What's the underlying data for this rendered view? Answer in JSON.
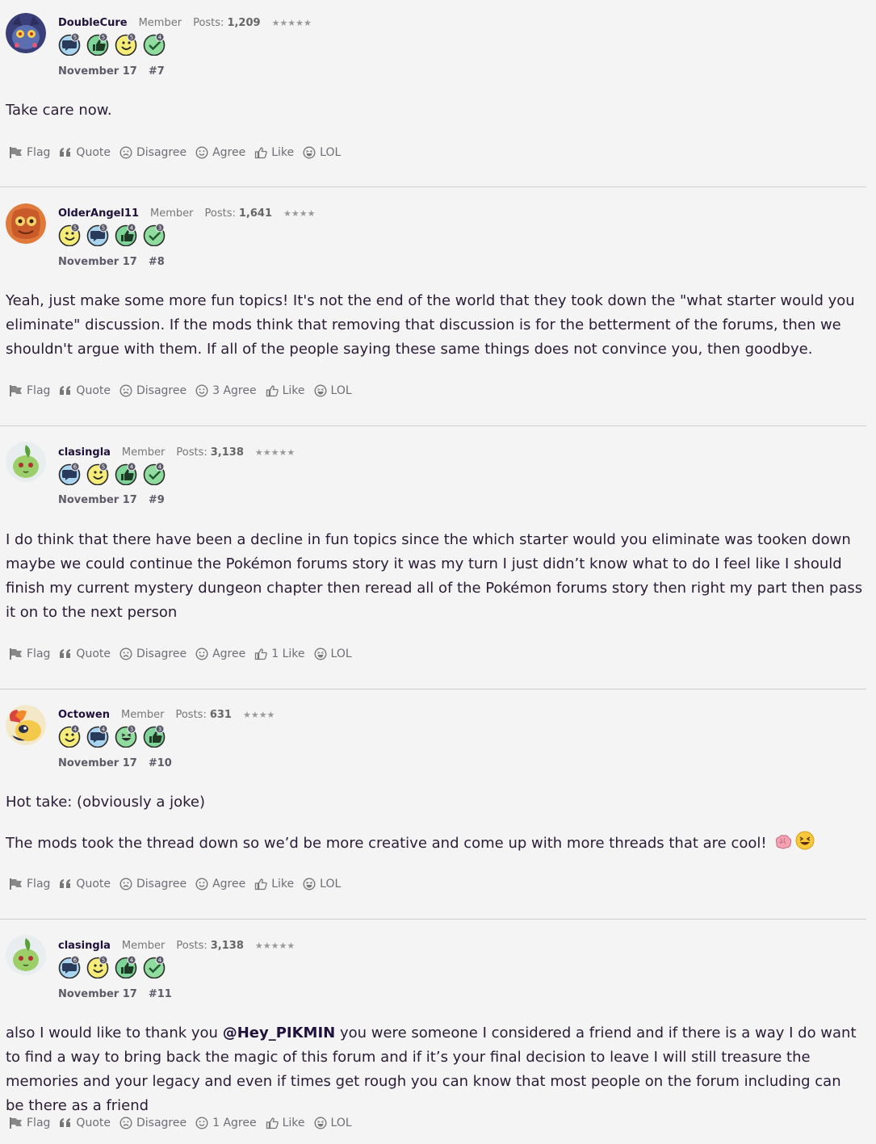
{
  "posts": [
    {
      "username": "DoubleCure",
      "role": "Member",
      "posts_label": "Posts:",
      "posts_count": "1,209",
      "stars": "★★★★★",
      "date": "November 17",
      "post_number": "#7",
      "badges": [
        {
          "type": "chat",
          "color": "#a8d4f0",
          "level": "5"
        },
        {
          "type": "thumb",
          "color": "#7fd49a",
          "level": "5"
        },
        {
          "type": "smile",
          "color": "#f5ec7a",
          "level": "5"
        },
        {
          "type": "check",
          "color": "#8fdc9e",
          "level": "4"
        }
      ],
      "paragraphs": [
        "Take care now."
      ],
      "actions": {
        "flag": "Flag",
        "quote": "Quote",
        "disagree": "Disagree",
        "agree": "Agree",
        "like": "Like",
        "lol": "LOL"
      }
    },
    {
      "username": "OlderAngel11",
      "role": "Member",
      "posts_label": "Posts:",
      "posts_count": "1,641",
      "stars": "★★★★",
      "date": "November 17",
      "post_number": "#8",
      "badges": [
        {
          "type": "smile",
          "color": "#f5ec7a",
          "level": "5"
        },
        {
          "type": "chat",
          "color": "#a8d4f0",
          "level": "5"
        },
        {
          "type": "thumb",
          "color": "#7fd49a",
          "level": "4"
        },
        {
          "type": "check",
          "color": "#8fdc9e",
          "level": "3"
        }
      ],
      "paragraphs": [
        "Yeah, just make some more fun topics! It's not the end of the world that they took down the \"what starter would you eliminate\" discussion. If the mods think that removing that discussion is for the betterment of the forums, then we shouldn't argue with them. If all of the people saying these same things does not convince you, then goodbye."
      ],
      "actions": {
        "flag": "Flag",
        "quote": "Quote",
        "disagree": "Disagree",
        "agree": "3 Agree",
        "like": "Like",
        "lol": "LOL"
      }
    },
    {
      "username": "clasingla",
      "role": "Member",
      "posts_label": "Posts:",
      "posts_count": "3,138",
      "stars": "★★★★★",
      "date": "November 17",
      "post_number": "#9",
      "badges": [
        {
          "type": "chat",
          "color": "#a8d4f0",
          "level": "6"
        },
        {
          "type": "smile",
          "color": "#f5ec7a",
          "level": "5"
        },
        {
          "type": "thumb",
          "color": "#7fd49a",
          "level": "4"
        },
        {
          "type": "check",
          "color": "#8fdc9e",
          "level": "4"
        }
      ],
      "paragraphs": [
        "I do think that there have been a decline in fun topics since the which starter would you eliminate was tooken down maybe we could continue the Pokémon forums story it was my turn I just didn’t know what to do I feel like I should finish my current mystery dungeon chapter then reread all of the Pokémon forums story then right my part then pass it on to the next person"
      ],
      "actions": {
        "flag": "Flag",
        "quote": "Quote",
        "disagree": "Disagree",
        "agree": "Agree",
        "like": "1 Like",
        "lol": "LOL"
      }
    },
    {
      "username": "Octowen",
      "role": "Member",
      "posts_label": "Posts:",
      "posts_count": "631",
      "stars": "★★★★",
      "date": "November 17",
      "post_number": "#10",
      "badges": [
        {
          "type": "smile",
          "color": "#f5ec7a",
          "level": "4"
        },
        {
          "type": "chat",
          "color": "#a8d4f0",
          "level": "4"
        },
        {
          "type": "laugh",
          "color": "#8fdc9e",
          "level": "3"
        },
        {
          "type": "thumb",
          "color": "#7fd49a",
          "level": "3"
        }
      ],
      "paragraphs": [
        "Hot take: (obviously a joke)",
        "The mods took the thread down so we’d be more creative and come up with more threads that are cool!"
      ],
      "actions": {
        "flag": "Flag",
        "quote": "Quote",
        "disagree": "Disagree",
        "agree": "Agree",
        "like": "Like",
        "lol": "LOL"
      }
    },
    {
      "username": "clasingla",
      "role": "Member",
      "posts_label": "Posts:",
      "posts_count": "3,138",
      "stars": "★★★★★",
      "date": "November 17",
      "post_number": "#11",
      "badges": [
        {
          "type": "chat",
          "color": "#a8d4f0",
          "level": "6"
        },
        {
          "type": "smile",
          "color": "#f5ec7a",
          "level": "5"
        },
        {
          "type": "thumb",
          "color": "#7fd49a",
          "level": "4"
        },
        {
          "type": "check",
          "color": "#8fdc9e",
          "level": "4"
        }
      ],
      "paragraphs": [
        "also I would like to thank you",
        "@Hey_PIKMIN",
        "you were someone I considered a friend and if there is a way I do want to find a way to bring back the magic of this forum and if it’s your final decision to leave I will still treasure the memories and your legacy and even if times get rough you can know that most people on the forum including can be there as a friend"
      ],
      "actions": {
        "flag": "Flag",
        "quote": "Quote",
        "disagree": "Disagree",
        "agree": "1 Agree",
        "like": "Like",
        "lol": "LOL"
      }
    }
  ],
  "icons": {
    "flag": "flag-icon",
    "quote": "quote-icon",
    "disagree": "frown-icon",
    "agree": "smile-icon",
    "like": "thumbs-up-icon",
    "lol": "laugh-icon",
    "emoji_1": "brain-emoji-icon",
    "emoji_2": "laughing-emoji-icon"
  }
}
